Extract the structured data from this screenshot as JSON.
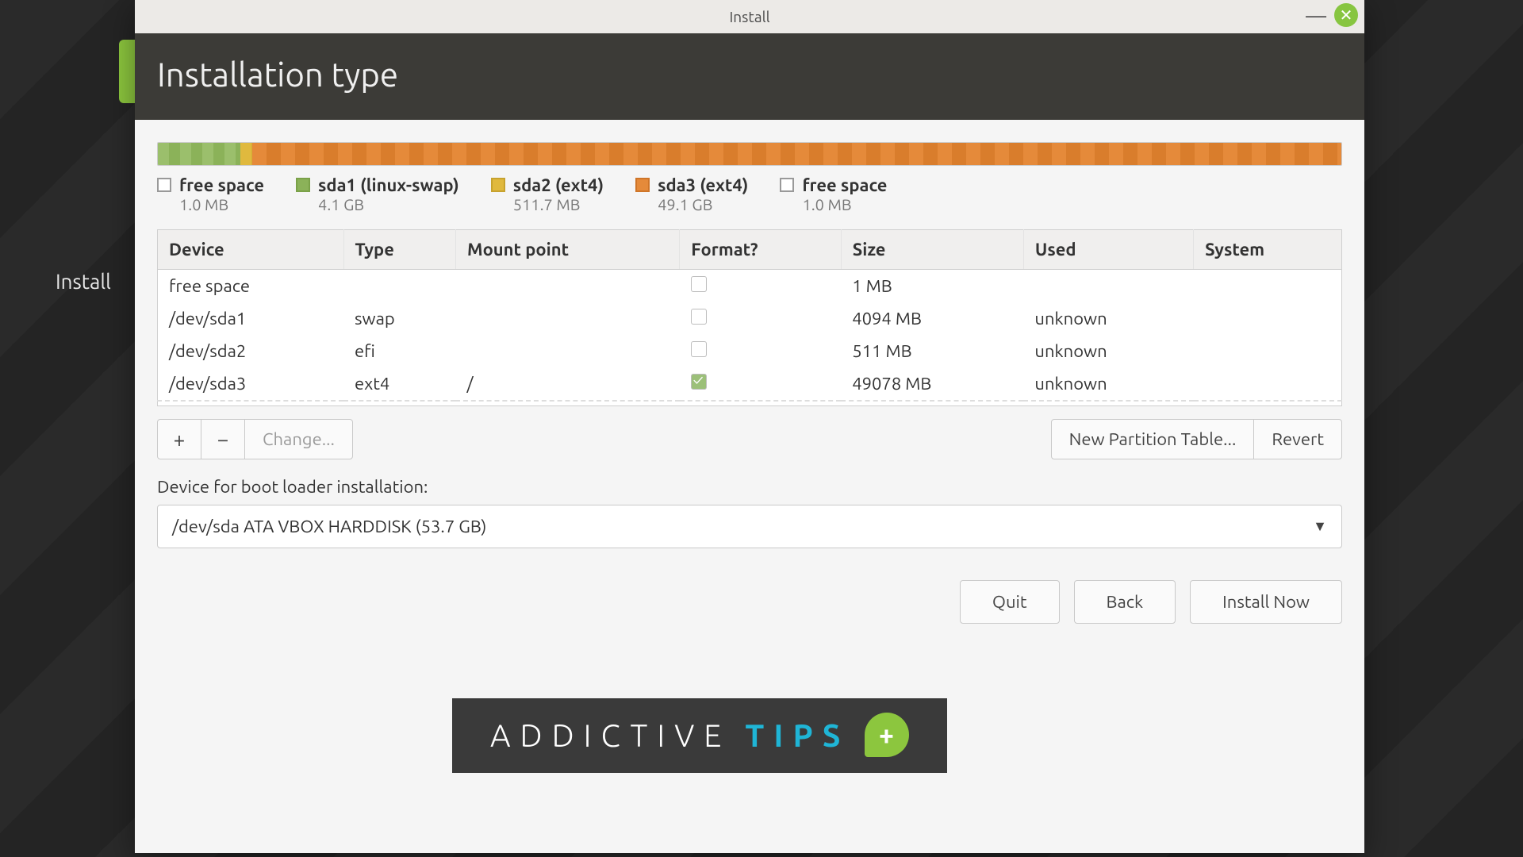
{
  "window": {
    "title": "Install"
  },
  "header": {
    "title": "Installation type"
  },
  "desktop": {
    "fragment_text": "Install"
  },
  "legend": [
    {
      "label": "free space",
      "size": "1.0 MB",
      "color": "none"
    },
    {
      "label": "sda1 (linux-swap)",
      "size": "4.1 GB",
      "color": "green"
    },
    {
      "label": "sda2 (ext4)",
      "size": "511.7 MB",
      "color": "yellow"
    },
    {
      "label": "sda3 (ext4)",
      "size": "49.1 GB",
      "color": "orange"
    },
    {
      "label": "free space",
      "size": "1.0 MB",
      "color": "none"
    }
  ],
  "columns": {
    "device": "Device",
    "type": "Type",
    "mount": "Mount point",
    "format": "Format?",
    "size": "Size",
    "used": "Used",
    "system": "System"
  },
  "rows": [
    {
      "device": "free space",
      "type": "",
      "mount": "",
      "format": false,
      "size": "1 MB",
      "used": "",
      "system": ""
    },
    {
      "device": "/dev/sda1",
      "type": "swap",
      "mount": "",
      "format": false,
      "size": "4094 MB",
      "used": "unknown",
      "system": ""
    },
    {
      "device": "/dev/sda2",
      "type": "efi",
      "mount": "",
      "format": false,
      "size": "511 MB",
      "used": "unknown",
      "system": ""
    },
    {
      "device": "/dev/sda3",
      "type": "ext4",
      "mount": "/",
      "format": true,
      "size": "49078 MB",
      "used": "unknown",
      "system": ""
    }
  ],
  "toolbar": {
    "add": "+",
    "remove": "−",
    "change": "Change...",
    "new_table": "New Partition Table...",
    "revert": "Revert"
  },
  "bootloader": {
    "label": "Device for boot loader installation:",
    "value": "/dev/sda   ATA VBOX HARDDISK (53.7 GB)"
  },
  "footer": {
    "quit": "Quit",
    "back": "Back",
    "install": "Install Now"
  },
  "watermark": {
    "a": "ADDICTIVE",
    "b": "TIPS",
    "plus": "+"
  }
}
